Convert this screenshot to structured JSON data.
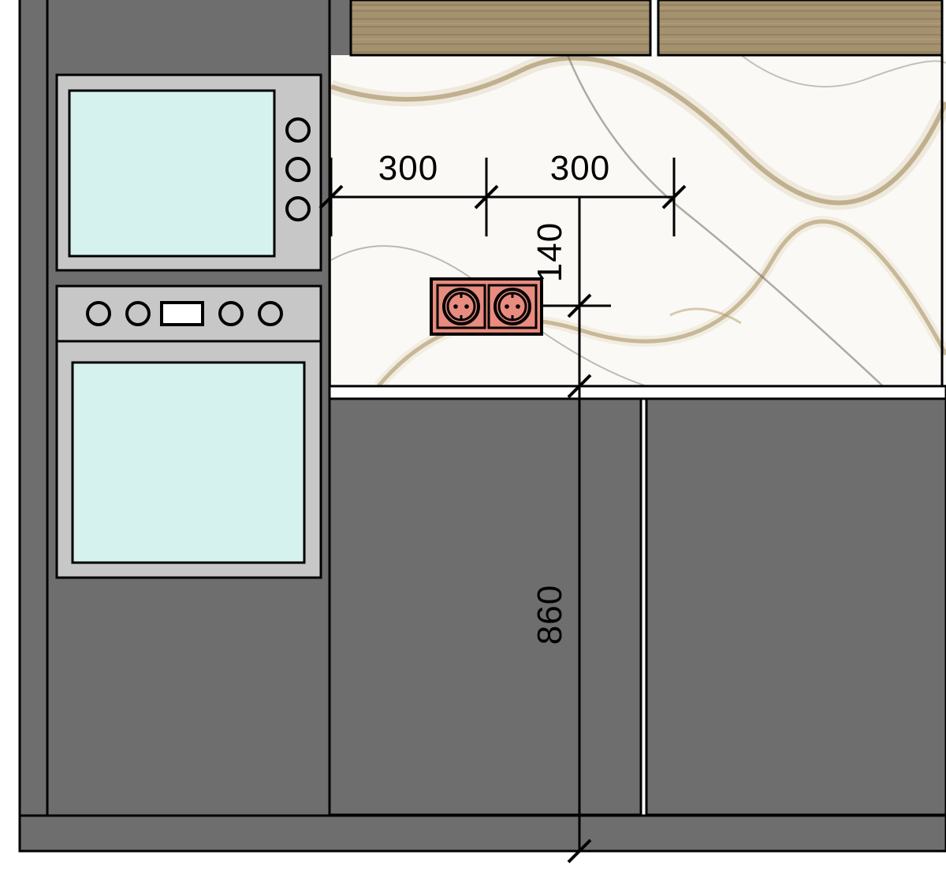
{
  "dimensions": {
    "horizontal_left": "300",
    "horizontal_right": "300",
    "vertical_upper": "140",
    "vertical_lower": "860"
  },
  "colors": {
    "cabinet_body": "#6e6e6e",
    "cabinet_plinth": "#6e6e6e",
    "appliance_frame": "#c7c7c7",
    "appliance_glass": "#d6f2ee",
    "marble_base": "#fbf9f6",
    "outline": "#000000",
    "outlet_fill": "#e98b7f",
    "wood_base": "#a3916f",
    "wood_dark": "#8c7a58",
    "wood_light": "#c3b38d"
  },
  "outlet": {
    "sockets": 2
  }
}
